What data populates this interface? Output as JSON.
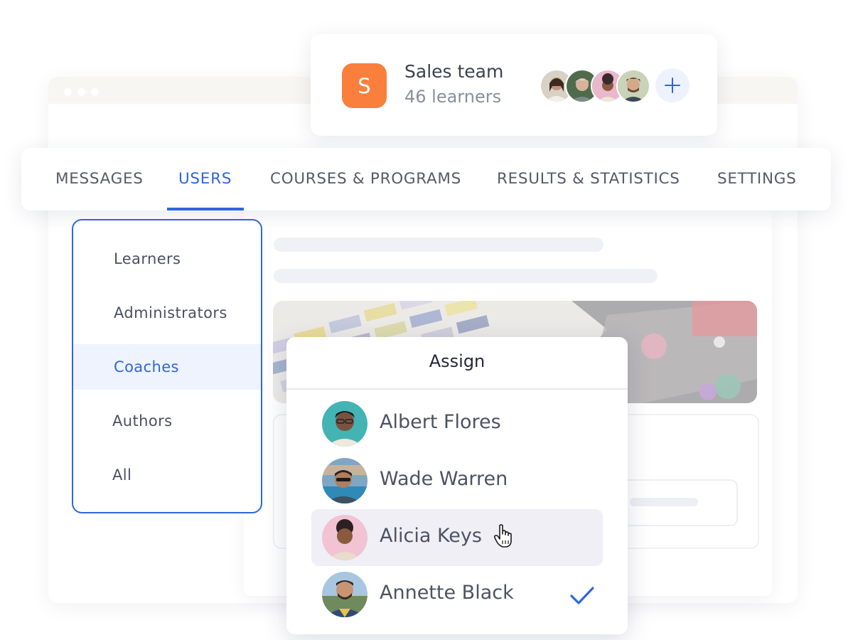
{
  "team": {
    "avatar_letter": "S",
    "name": "Sales team",
    "count": "46 learners",
    "avatar_color": "#fb7f3c"
  },
  "nav": {
    "tabs": [
      {
        "label": "MESSAGES"
      },
      {
        "label": "USERS",
        "active": true
      },
      {
        "label": "COURSES & PROGRAMS"
      },
      {
        "label": "RESULTS & STATISTICS"
      },
      {
        "label": "SETTINGS"
      }
    ]
  },
  "side_menu": {
    "items": [
      {
        "label": "Learners"
      },
      {
        "label": "Administrators"
      },
      {
        "label": "Coaches",
        "active": true
      },
      {
        "label": "Authors"
      },
      {
        "label": "All"
      }
    ]
  },
  "assign": {
    "title": "Assign",
    "people": [
      {
        "name": "Albert Flores"
      },
      {
        "name": "Wade Warren"
      },
      {
        "name": "Alicia Keys",
        "hovered": true
      },
      {
        "name": "Annette Black",
        "checked": true
      }
    ]
  },
  "colors": {
    "accent": "#2f66e0",
    "brand_orange": "#fb7f3c",
    "text_dark": "#3b4252"
  },
  "icons": [
    "plus-icon",
    "check-icon",
    "hand-pointer-cursor-icon"
  ]
}
